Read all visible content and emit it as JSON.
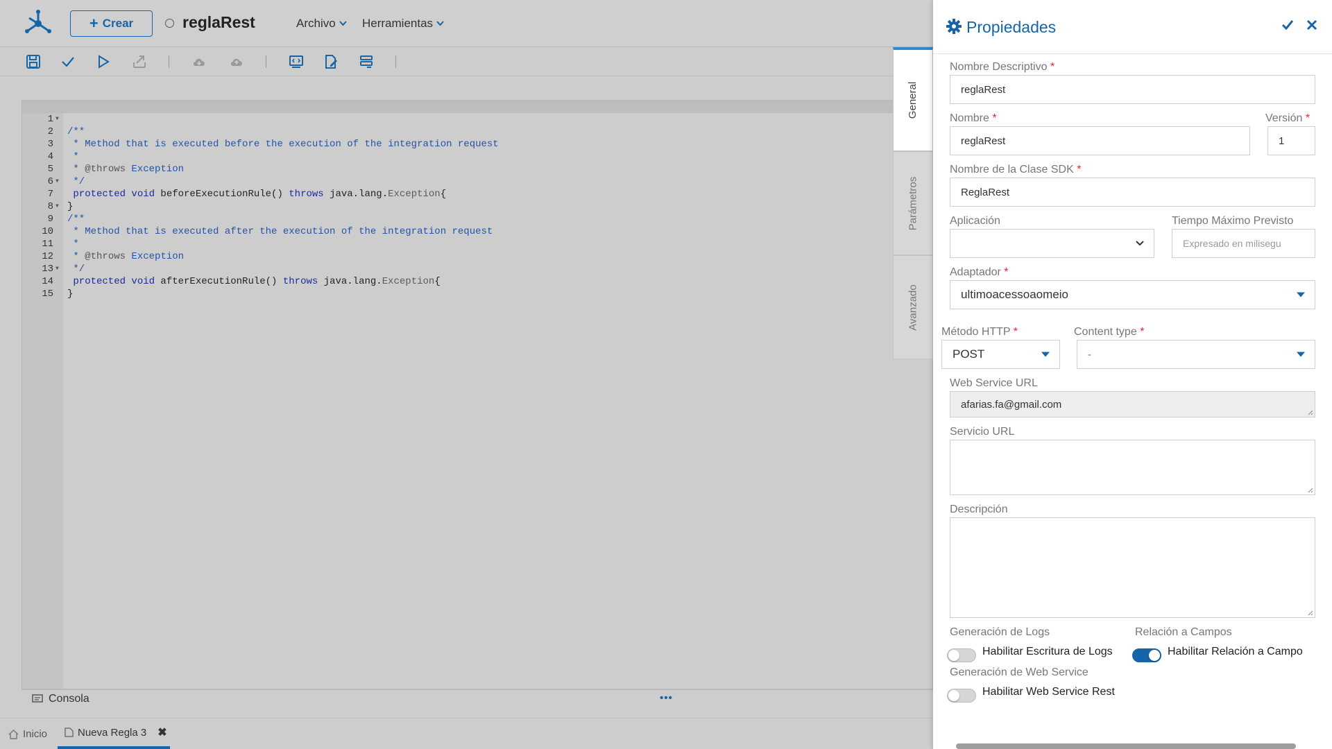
{
  "header": {
    "create_label": "Crear",
    "rule_name": "reglaRest",
    "menus": [
      {
        "label": "Archivo"
      },
      {
        "label": "Herramientas"
      }
    ]
  },
  "toolbar": {
    "icons": [
      "save-icon",
      "validate-check-icon",
      "run-play-icon",
      "export-icon",
      "cloud-download-icon",
      "cloud-upload-icon",
      "code-template-icon",
      "document-edit-icon",
      "format-list-icon"
    ]
  },
  "editor": {
    "lines": [
      {
        "n": "1",
        "fold": true
      },
      {
        "n": "2"
      },
      {
        "n": "3"
      },
      {
        "n": "4"
      },
      {
        "n": "5"
      },
      {
        "n": "6",
        "fold": true
      },
      {
        "n": "7"
      },
      {
        "n": "8",
        "fold": true
      },
      {
        "n": "9"
      },
      {
        "n": "10"
      },
      {
        "n": "11"
      },
      {
        "n": "12"
      },
      {
        "n": "13",
        "fold": true
      },
      {
        "n": "14"
      },
      {
        "n": "15"
      }
    ],
    "code": {
      "l1": "/**",
      "l2": " * Method that is executed before the execution of the integration request",
      "l3": " *",
      "l4_star": " * ",
      "l4_tag": "@throws",
      "l4_exc": " Exception",
      "l5": " */",
      "l6_kw1": " protected void ",
      "l6_fn": "beforeExecutionRule() ",
      "l6_kw2": "throws ",
      "l6_pkg": "java.lang.",
      "l6_cls": "Exception",
      "l6_end": "{",
      "l7": "}",
      "l8": "/**",
      "l9": " * Method that is executed after the execution of the integration request",
      "l10": " *",
      "l11_star": " * ",
      "l11_tag": "@throws",
      "l11_exc": " Exception",
      "l12": " */",
      "l13_kw1": " protected void ",
      "l13_fn": "afterExecutionRule() ",
      "l13_kw2": "throws ",
      "l13_pkg": "java.lang.",
      "l13_cls": "Exception",
      "l13_end": "{",
      "l14": "}"
    }
  },
  "console": {
    "label": "Consola",
    "more": "•••"
  },
  "bottom_tabs": [
    {
      "label": "Inicio"
    },
    {
      "label": "Nueva Regla 3"
    }
  ],
  "side_tabs": [
    {
      "label": "General"
    },
    {
      "label": "Parámetros"
    },
    {
      "label": "Avanzado"
    }
  ],
  "panel": {
    "title": "Propiedades",
    "required_mark": "*",
    "fields": {
      "nombre_descriptivo": {
        "label": "Nombre Descriptivo",
        "value": "reglaRest"
      },
      "nombre": {
        "label": "Nombre",
        "value": "reglaRest"
      },
      "version": {
        "label": "Versión",
        "value": "1"
      },
      "clase_sdk": {
        "label": "Nombre de la Clase SDK",
        "value": "ReglaRest"
      },
      "aplicacion": {
        "label": "Aplicación",
        "value": ""
      },
      "tiempo_maximo": {
        "label": "Tiempo Máximo Previsto",
        "placeholder": "Expresado en milisegu"
      },
      "adaptador": {
        "label": "Adaptador",
        "value": "ultimoacessoaomeio"
      },
      "metodo_http": {
        "label": "Método HTTP",
        "value": "POST"
      },
      "content_type": {
        "label": "Content type",
        "value": "-"
      },
      "web_service_url": {
        "label": "Web Service URL",
        "value": "afarias.fa@gmail.com"
      },
      "servicio_url": {
        "label": "Servicio URL",
        "value": ""
      },
      "descripcion": {
        "label": "Descripción",
        "value": ""
      }
    },
    "logs": {
      "section": "Generación de Logs",
      "toggle_label": "Habilitar Escritura de Logs",
      "enabled": false
    },
    "relacion": {
      "section": "Relación a Campos",
      "toggle_label": "Habilitar Relación a Campo",
      "enabled": true
    },
    "web_service": {
      "section": "Generación de Web Service",
      "toggle_label": "Habilitar Web Service Rest",
      "enabled": false
    }
  },
  "colors": {
    "accent": "#1565a8",
    "required": "#d32f2f",
    "overlay": "#cdcdcd"
  }
}
